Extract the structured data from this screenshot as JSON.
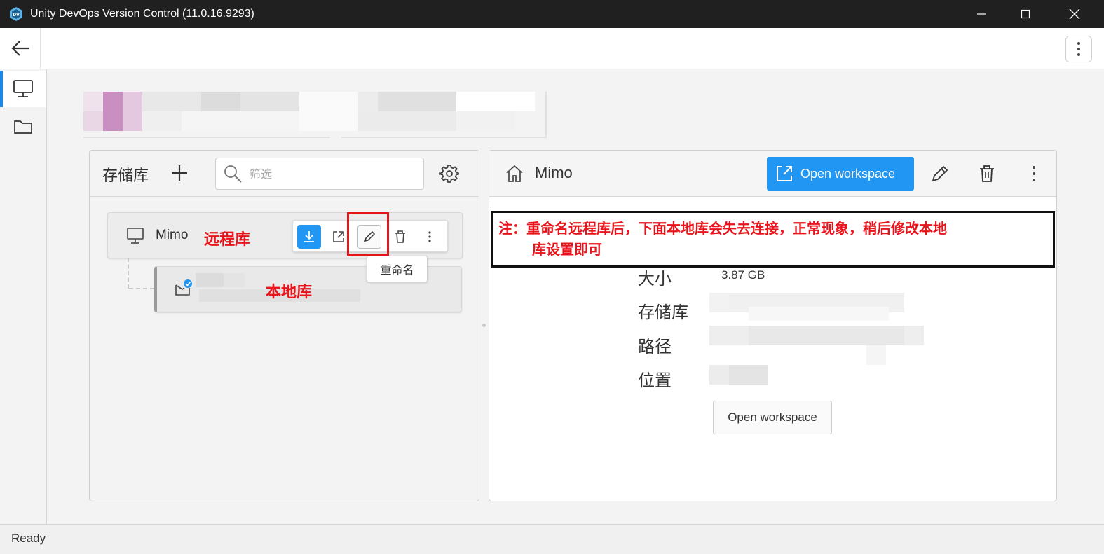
{
  "window": {
    "title": "Unity DevOps Version Control (11.0.16.9293)"
  },
  "left_panel": {
    "heading": "存储库",
    "filter_placeholder": "筛选",
    "repo": {
      "name": "Mimo",
      "annotation": "远程库",
      "tooltip": "重命名"
    },
    "workspace": {
      "annotation": "本地库"
    }
  },
  "right_panel": {
    "title": "Mimo",
    "open_workspace_label": "Open workspace",
    "note_line1": "注：重命名远程库后，下面本地库会失去连接，正常现象，稍后修改本地",
    "note_line2": "库设置即可",
    "details": [
      {
        "label": "大小",
        "value": "3.87 GB"
      },
      {
        "label": "存储库",
        "value": ""
      },
      {
        "label": "路径",
        "value": ""
      },
      {
        "label": "位置",
        "value": ""
      }
    ],
    "secondary_button_label": "Open workspace"
  },
  "status": {
    "text": "Ready"
  },
  "colors": {
    "accent": "#2196f3",
    "annotation_red": "#e8141b",
    "titlebar": "#202020"
  }
}
